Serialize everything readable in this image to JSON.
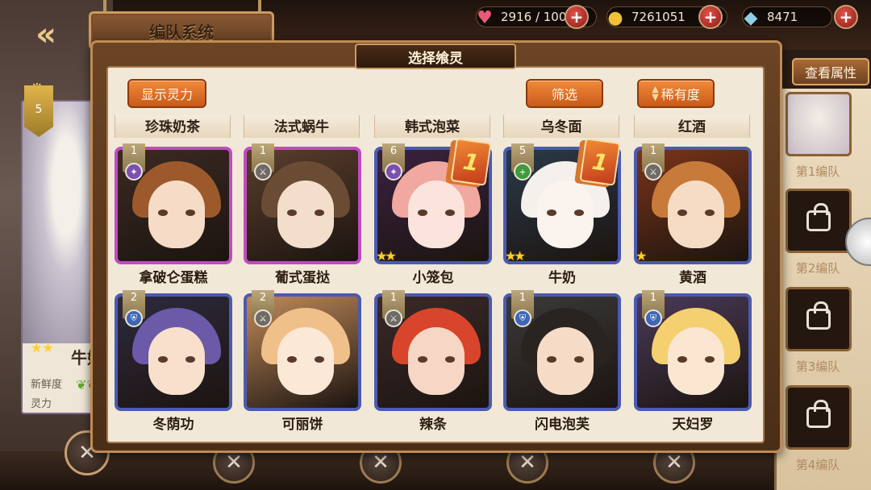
{
  "top_bar": {
    "team_title": "编队系统",
    "back_icon": "back-arrow-icon",
    "stamina": "2916 / 100",
    "gold": "7261051",
    "gems": "8471",
    "plus_label": "+"
  },
  "selected_character": {
    "level": "5",
    "name": "牛奶",
    "freshness_label": "新鲜度",
    "power_label": "灵力"
  },
  "panel": {
    "title": "选择飨灵",
    "show_power_button": "显示灵力",
    "filter_button": "筛选",
    "rarity_sort_button": "稀有度",
    "column_headers": [
      "珍珠奶茶",
      "法式蜗牛",
      "韩式泡菜",
      "乌冬面",
      "红酒"
    ]
  },
  "cards": [
    {
      "name": "拿破仑蛋糕",
      "level": "1",
      "type": "purple",
      "frame": "purple",
      "team": "",
      "stars": "",
      "hair": "#9c5a2c",
      "face": "#f6dcc6",
      "bg": "#3b2a22"
    },
    {
      "name": "葡式蛋挞",
      "level": "1",
      "type": "grey",
      "frame": "purple",
      "team": "",
      "stars": "",
      "hair": "#6a4c34",
      "face": "#f3ddcb",
      "bg": "#5a3e2c"
    },
    {
      "name": "小笼包",
      "level": "6",
      "type": "purple",
      "frame": "blue",
      "team": "1",
      "stars": "★★",
      "hair": "#f0a8a0",
      "face": "#fbe4dc",
      "bg": "#3a2240"
    },
    {
      "name": "牛奶",
      "level": "5",
      "type": "green",
      "frame": "blue",
      "team": "1",
      "stars": "★★",
      "hair": "#f4f0ec",
      "face": "#fbf3ee",
      "bg": "#2a3a48"
    },
    {
      "name": "黄酒",
      "level": "1",
      "type": "grey",
      "frame": "blue",
      "team": "",
      "stars": "★",
      "hair": "#c77a3a",
      "face": "#f6dcc4",
      "bg": "#7a3418"
    },
    {
      "name": "冬荫功",
      "level": "2",
      "type": "blue",
      "frame": "blue",
      "team": "",
      "stars": "",
      "hair": "#6a5aa8",
      "face": "#f8e0cc",
      "bg": "#2e2a3e"
    },
    {
      "name": "可丽饼",
      "level": "2",
      "type": "grey",
      "frame": "blue",
      "team": "",
      "stars": "",
      "hair": "#f0c08a",
      "face": "#fbe8d6",
      "bg": "#c08a5a"
    },
    {
      "name": "辣条",
      "level": "1",
      "type": "grey",
      "frame": "blue",
      "team": "",
      "stars": "",
      "hair": "#d8452a",
      "face": "#f6d6c4",
      "bg": "#3a2a2a"
    },
    {
      "name": "闪电泡芙",
      "level": "1",
      "type": "blue",
      "frame": "blue",
      "team": "",
      "stars": "",
      "hair": "#2a2420",
      "face": "#f6dcc6",
      "bg": "#3a3a3a"
    },
    {
      "name": "天妇罗",
      "level": "1",
      "type": "blue",
      "frame": "blue",
      "team": "",
      "stars": "",
      "hair": "#f4d070",
      "face": "#fbe6d2",
      "bg": "#4a3a58"
    }
  ],
  "right_rail": {
    "view_attributes_button": "查看属性",
    "team_labels": [
      "第1编队",
      "第2编队",
      "第3编队",
      "第4编队"
    ]
  },
  "colors": {
    "accent_orange": "#f28a3c",
    "panel_bg": "#f2e8d8",
    "frame_brown": "#6b4424"
  }
}
